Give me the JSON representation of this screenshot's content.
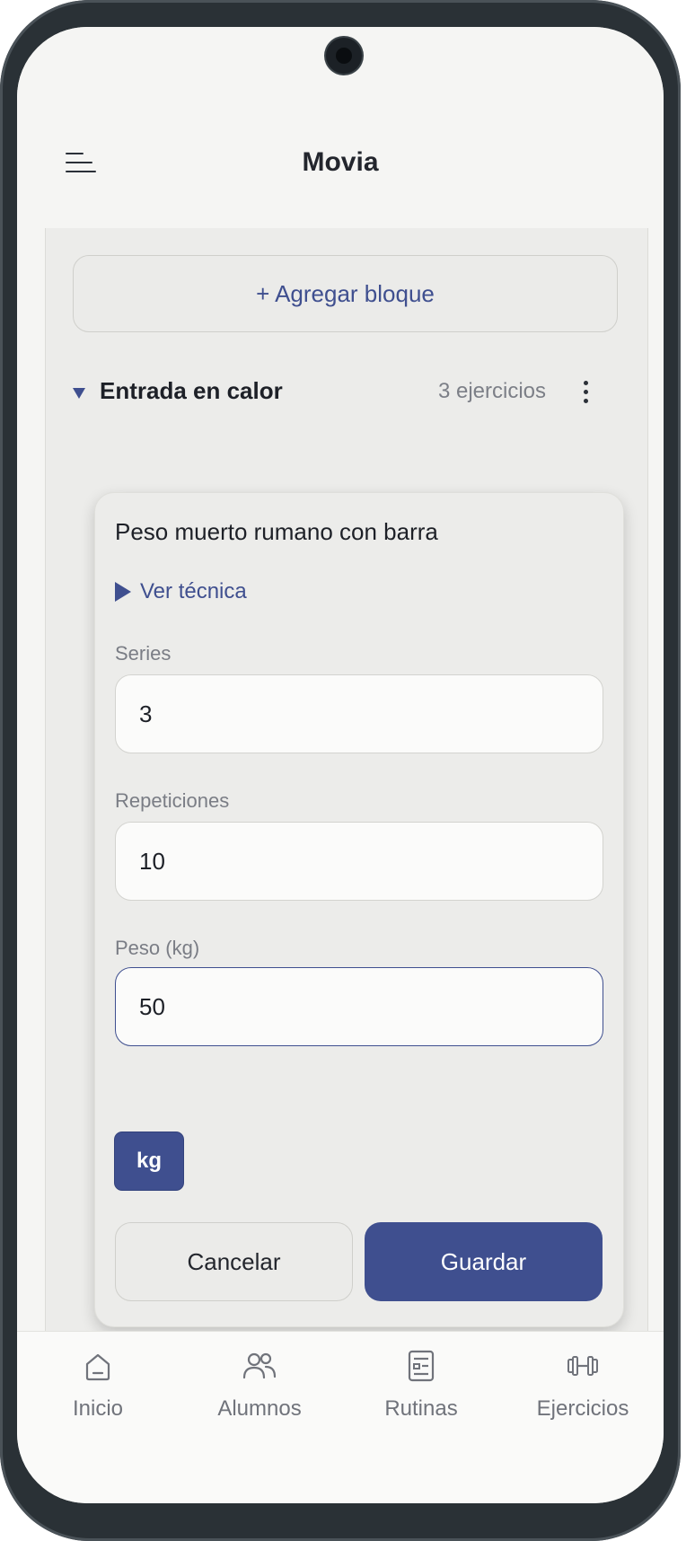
{
  "header": {
    "title": "Movia",
    "menu_icon": "menu-icon"
  },
  "actions": {
    "add_block_label": "+ Agregar bloque"
  },
  "section": {
    "title": "Entrada en calor",
    "count": "3 ejercicios",
    "expanded": true
  },
  "exercise": {
    "name": "Peso muerto rumano con barra",
    "technique_link": "Ver técnica",
    "fields": {
      "series": {
        "label": "Series",
        "value": "3"
      },
      "reps": {
        "label": "Repeticiones",
        "value": "10"
      },
      "weight": {
        "label": "Peso (kg)",
        "value": "50",
        "focused": true
      }
    },
    "unit_chip": "kg",
    "cancel_label": "Cancelar",
    "save_label": "Guardar"
  },
  "bottom_nav": {
    "items": [
      {
        "label": "Inicio",
        "icon": "home-icon"
      },
      {
        "label": "Alumnos",
        "icon": "users-icon"
      },
      {
        "label": "Rutinas",
        "icon": "routine-list-icon"
      },
      {
        "label": "Ejercicios",
        "icon": "dumbbell-icon"
      }
    ]
  },
  "colors": {
    "accent": "#3f4f8f",
    "background": "#f5f5f3",
    "content_bg": "#ececea",
    "text": "#1d2027",
    "muted": "#7a7d85"
  }
}
